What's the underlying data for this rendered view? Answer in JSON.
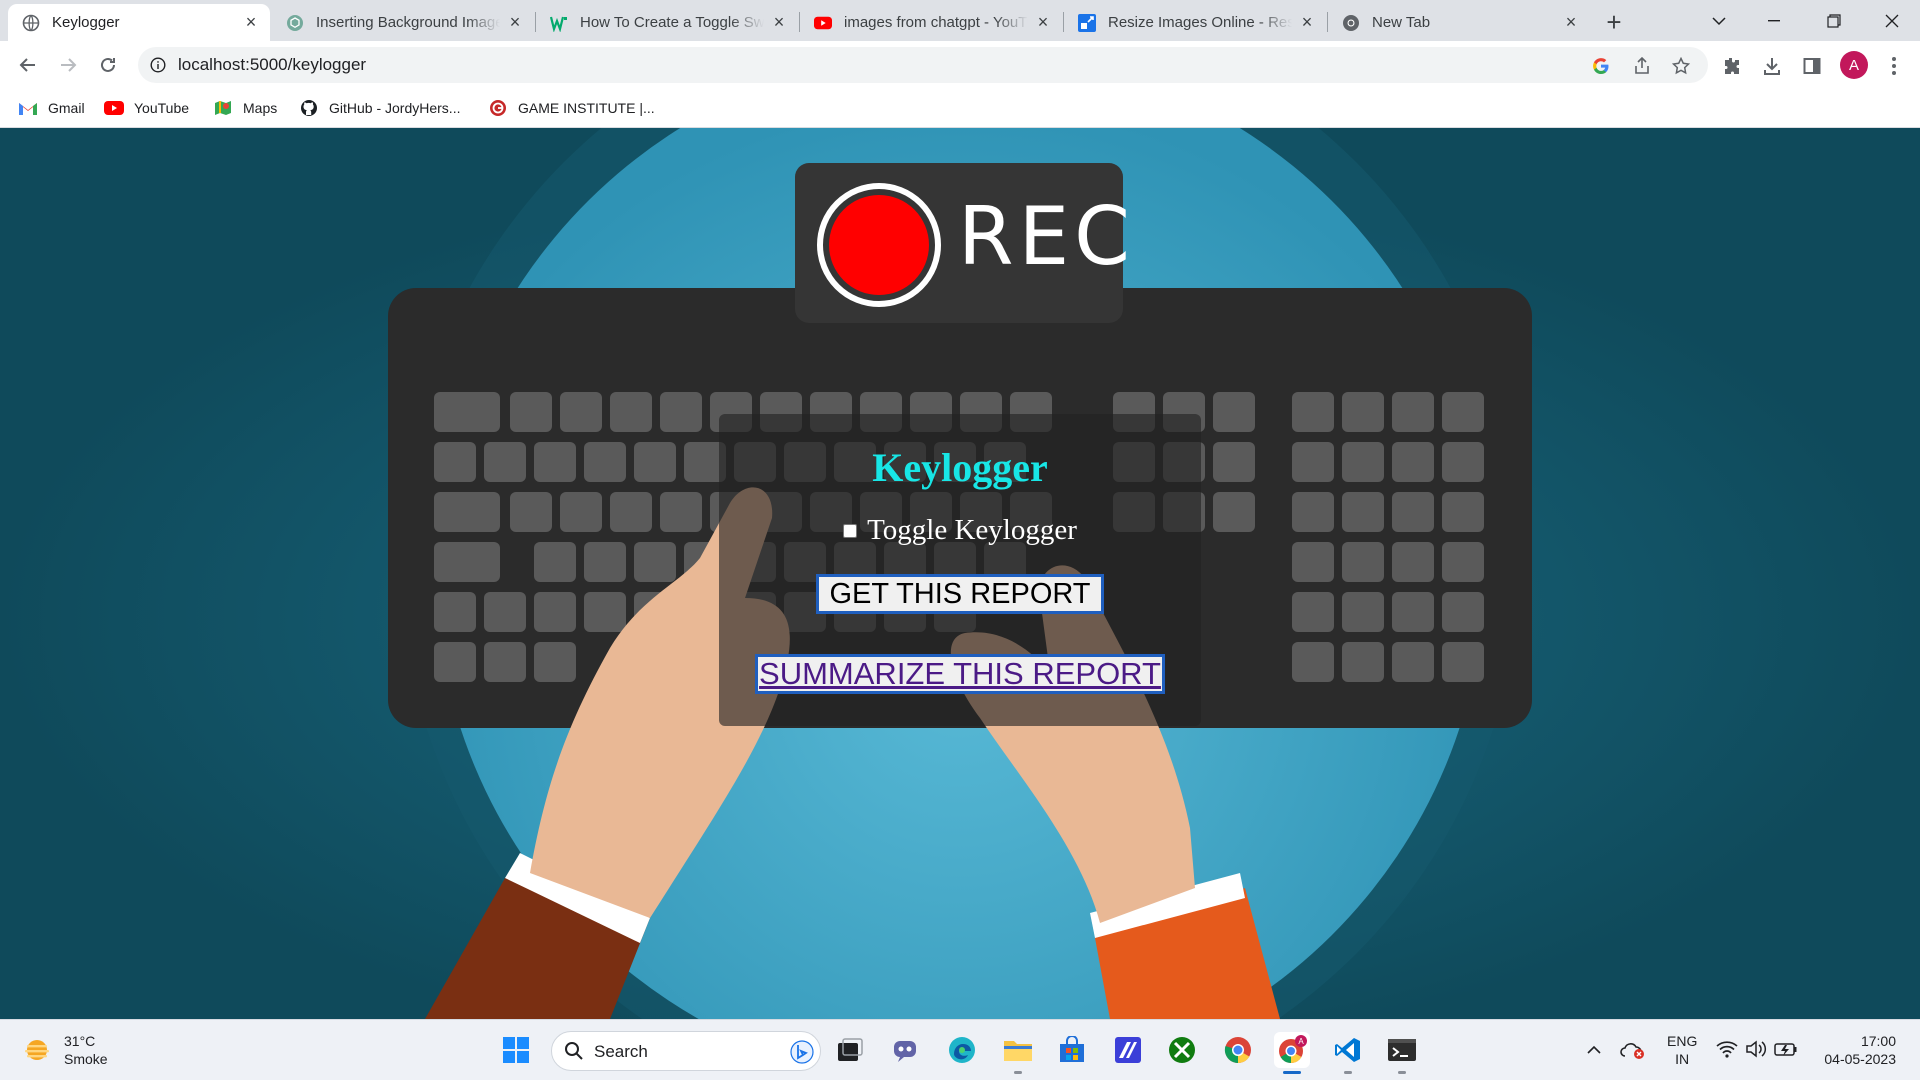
{
  "browser": {
    "tabs": [
      {
        "title": "Keylogger",
        "active": true,
        "favicon": "globe-icon"
      },
      {
        "title": "Inserting Background Image",
        "active": false,
        "favicon": "chatgpt-icon"
      },
      {
        "title": "How To Create a Toggle Switch",
        "active": false,
        "favicon": "w3schools-icon"
      },
      {
        "title": "images from chatgpt - YouTube",
        "active": false,
        "favicon": "youtube-icon"
      },
      {
        "title": "Resize Images Online - Resize",
        "active": false,
        "favicon": "resize-icon"
      },
      {
        "title": "New Tab",
        "active": false,
        "favicon": "chrome-icon"
      }
    ],
    "url": "localhost:5000/keylogger",
    "bookmarks": [
      {
        "label": "Gmail",
        "icon": "gmail-icon"
      },
      {
        "label": "YouTube",
        "icon": "youtube-icon"
      },
      {
        "label": "Maps",
        "icon": "maps-icon"
      },
      {
        "label": "GitHub - JordyHers...",
        "icon": "github-icon"
      },
      {
        "label": "GAME INSTITUTE |...",
        "icon": "game-institute-icon"
      }
    ],
    "profile_initial": "A"
  },
  "page": {
    "rec_label": "REC",
    "heading": "Keylogger",
    "toggle_label": "Toggle Keylogger",
    "toggle_checked": false,
    "get_report_label": "GET THIS REPORT",
    "summarize_label": "SUMMARIZE THIS REPORT"
  },
  "taskbar": {
    "weather_temp": "31°C",
    "weather_desc": "Smoke",
    "search_placeholder": "Search",
    "lang_line1": "ENG",
    "lang_line2": "IN",
    "time": "17:00",
    "date": "04-05-2023",
    "apps": [
      "start-icon",
      "search-icon",
      "task-view-icon",
      "teams-icon",
      "edge-icon",
      "file-explorer-icon",
      "store-icon",
      "mathpix-icon",
      "xbox-icon",
      "chrome-icon",
      "chrome-profile-icon",
      "vscode-icon",
      "terminal-icon"
    ]
  },
  "colors": {
    "rec_red": "#ff0000",
    "heading_cyan": "#18e6e6",
    "button_border": "#1f5fbf",
    "link_purple": "#4b1a86",
    "page_bg": "#0f4a5b",
    "circle_blue": "#3ea7c7"
  }
}
